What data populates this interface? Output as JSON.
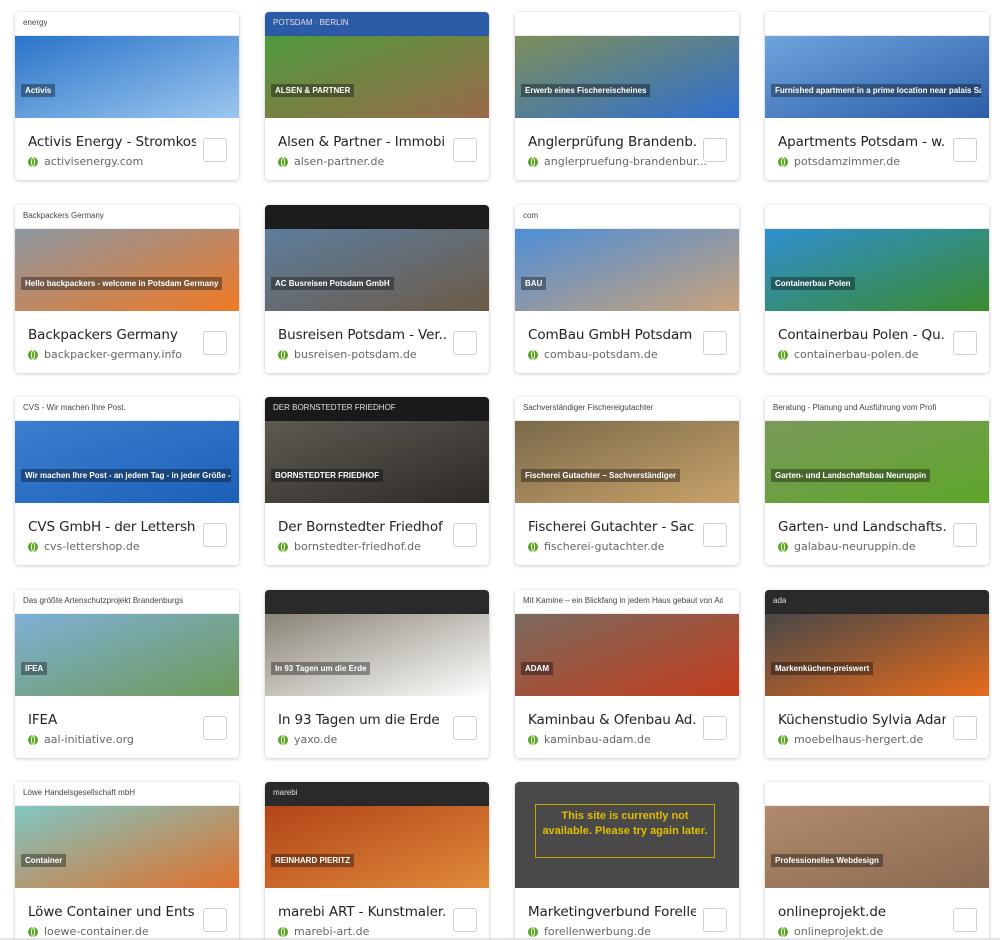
{
  "sites": [
    {
      "title": "Activis Energy - Stromkos...",
      "domain": "activisenergy.com",
      "thumb_text": "Activis",
      "thumb_sub": "energy",
      "colors": [
        "#ffffff",
        "#2a74c9",
        "#9cc7ef"
      ]
    },
    {
      "title": "Alsen & Partner - Immobi...",
      "domain": "alsen-partner.de",
      "thumb_text": "ALSEN & PARTNER",
      "thumb_sub": "POTSDAM · BERLIN",
      "colors": [
        "#2b5aa6",
        "#4f9a3c",
        "#9a6a4a"
      ]
    },
    {
      "title": "Anglerprüfung Brandenb...",
      "domain": "anglerpruefung-brandenbur...",
      "thumb_text": "Erwerb eines Fischereischeines",
      "thumb_sub": "",
      "colors": [
        "#ffffff",
        "#7e8f5a",
        "#2f6fcf"
      ]
    },
    {
      "title": "Apartments Potsdam - w...",
      "domain": "potsdamzimmer.de",
      "thumb_text": "Furnished apartment in a prime location near palais Sanssouci",
      "thumb_sub": "",
      "colors": [
        "#ffffff",
        "#6fa4dd",
        "#2c5ea8"
      ]
    },
    {
      "title": "Backpackers Germany",
      "domain": "backpacker-germany.info",
      "thumb_text": "Hello backpackers - welcome in Potsdam Germany",
      "thumb_sub": "Backpackers Germany",
      "colors": [
        "#ffffff",
        "#8c97a3",
        "#f07a25"
      ]
    },
    {
      "title": "Busreisen Potsdam - Ver...",
      "domain": "busreisen-potsdam.de",
      "thumb_text": "AC Busreisen Potsdam GmbH",
      "thumb_sub": "",
      "colors": [
        "#1c1c1c",
        "#5d7e9e",
        "#6c5a46"
      ]
    },
    {
      "title": "ComBau GmbH Potsdam",
      "domain": "combau-potsdam.de",
      "thumb_text": "BAU",
      "thumb_sub": "com",
      "colors": [
        "#ffffff",
        "#4d8ed8",
        "#c9a27a"
      ]
    },
    {
      "title": "Containerbau Polen - Qu...",
      "domain": "containerbau-polen.de",
      "thumb_text": "Containerbau Polen",
      "thumb_sub": "",
      "colors": [
        "#ffffff",
        "#2f8fd1",
        "#3a8b2d"
      ]
    },
    {
      "title": "CVS GmbH - der Lettersh...",
      "domain": "cvs-lettershop.de",
      "thumb_text": "Wir machen Ihre Post - an jedem Tag - in jeder Größe - in jeder Menge - zu jedem Ort und genau auf den Punkt - versprochen!",
      "thumb_sub": "CVS - Wir machen Ihre Post.",
      "colors": [
        "#ffffff",
        "#3a7fd0",
        "#1d5fb8"
      ]
    },
    {
      "title": "Der Bornstedter Friedhof",
      "domain": "bornstedter-friedhof.de",
      "thumb_text": "BORNSTEDTER FRIEDHOF",
      "thumb_sub": "DER BORNSTEDTER FRIEDHOF",
      "colors": [
        "#1a1a1a",
        "#5d5a52",
        "#2d2a26"
      ]
    },
    {
      "title": "Fischerei Gutachter - Sac...",
      "domain": "fischerei-gutachter.de",
      "thumb_text": "Fischerei Gutachter – Sachverständiger",
      "thumb_sub": "Sachverständiger Fischereigutachter",
      "colors": [
        "#ffffff",
        "#7a6a4a",
        "#c9a26a"
      ]
    },
    {
      "title": "Garten- und Landschafts...",
      "domain": "galabau-neuruppin.de",
      "thumb_text": "Garten- und Landschaftsbau Neuruppin",
      "thumb_sub": "Beratung - Planung und Ausführung vom Profi",
      "colors": [
        "#ffffff",
        "#7a9a5a",
        "#5ea62a"
      ]
    },
    {
      "title": "IFEA",
      "domain": "aal-initiative.org",
      "thumb_text": "IFEA",
      "thumb_sub": "Das größte Artenschutzprojekt Brandenburgs",
      "colors": [
        "#ffffff",
        "#7fb0d6",
        "#6d9a58"
      ]
    },
    {
      "title": "In 93 Tagen um die Erde",
      "domain": "yaxo.de",
      "thumb_text": "In 93 Tagen um die Erde",
      "thumb_sub": "",
      "colors": [
        "#2a2a2a",
        "#8a8476",
        "#ffffff"
      ]
    },
    {
      "title": "Kaminbau & Ofenbau Ad...",
      "domain": "kaminbau-adam.de",
      "thumb_text": "ADAM",
      "thumb_sub": "Mit Kamine – ein Blickfang in jedem Haus gebaut von Adam",
      "colors": [
        "#ffffff",
        "#7a6a5e",
        "#c43c1c"
      ]
    },
    {
      "title": "Küchenstudio Sylvia Adam",
      "domain": "moebelhaus-hergert.de",
      "thumb_text": "Markenküchen-preiswert",
      "thumb_sub": "ada",
      "colors": [
        "#2a2a2a",
        "#484848",
        "#e76b1a"
      ]
    },
    {
      "title": "Löwe Container und Ents...",
      "domain": "loewe-container.de",
      "thumb_text": "Container",
      "thumb_sub": "Löwe Handelsgesellschaft mbH",
      "colors": [
        "#ffffff",
        "#7ec7c3",
        "#e0702a"
      ]
    },
    {
      "title": "marebi ART - Kunstmaler...",
      "domain": "marebi-art.de",
      "thumb_text": "REINHARD PIERITZ",
      "thumb_sub": "marebi",
      "colors": [
        "#2a2a2a",
        "#b34418",
        "#e08a3a"
      ]
    },
    {
      "title": "Marketingverbund Forelle",
      "domain": "forellenwerbung.de",
      "thumb_text": "This site is currently not available. Please try again later.",
      "thumb_sub": "",
      "colors": [
        "#494949",
        "#494949",
        "#494949"
      ]
    },
    {
      "title": "onlineprojekt.de",
      "domain": "onlineprojekt.de",
      "thumb_text": "Professionelles Webdesign",
      "thumb_sub": "",
      "colors": [
        "#ffffff",
        "#b08a6a",
        "#8a6a52"
      ]
    }
  ]
}
